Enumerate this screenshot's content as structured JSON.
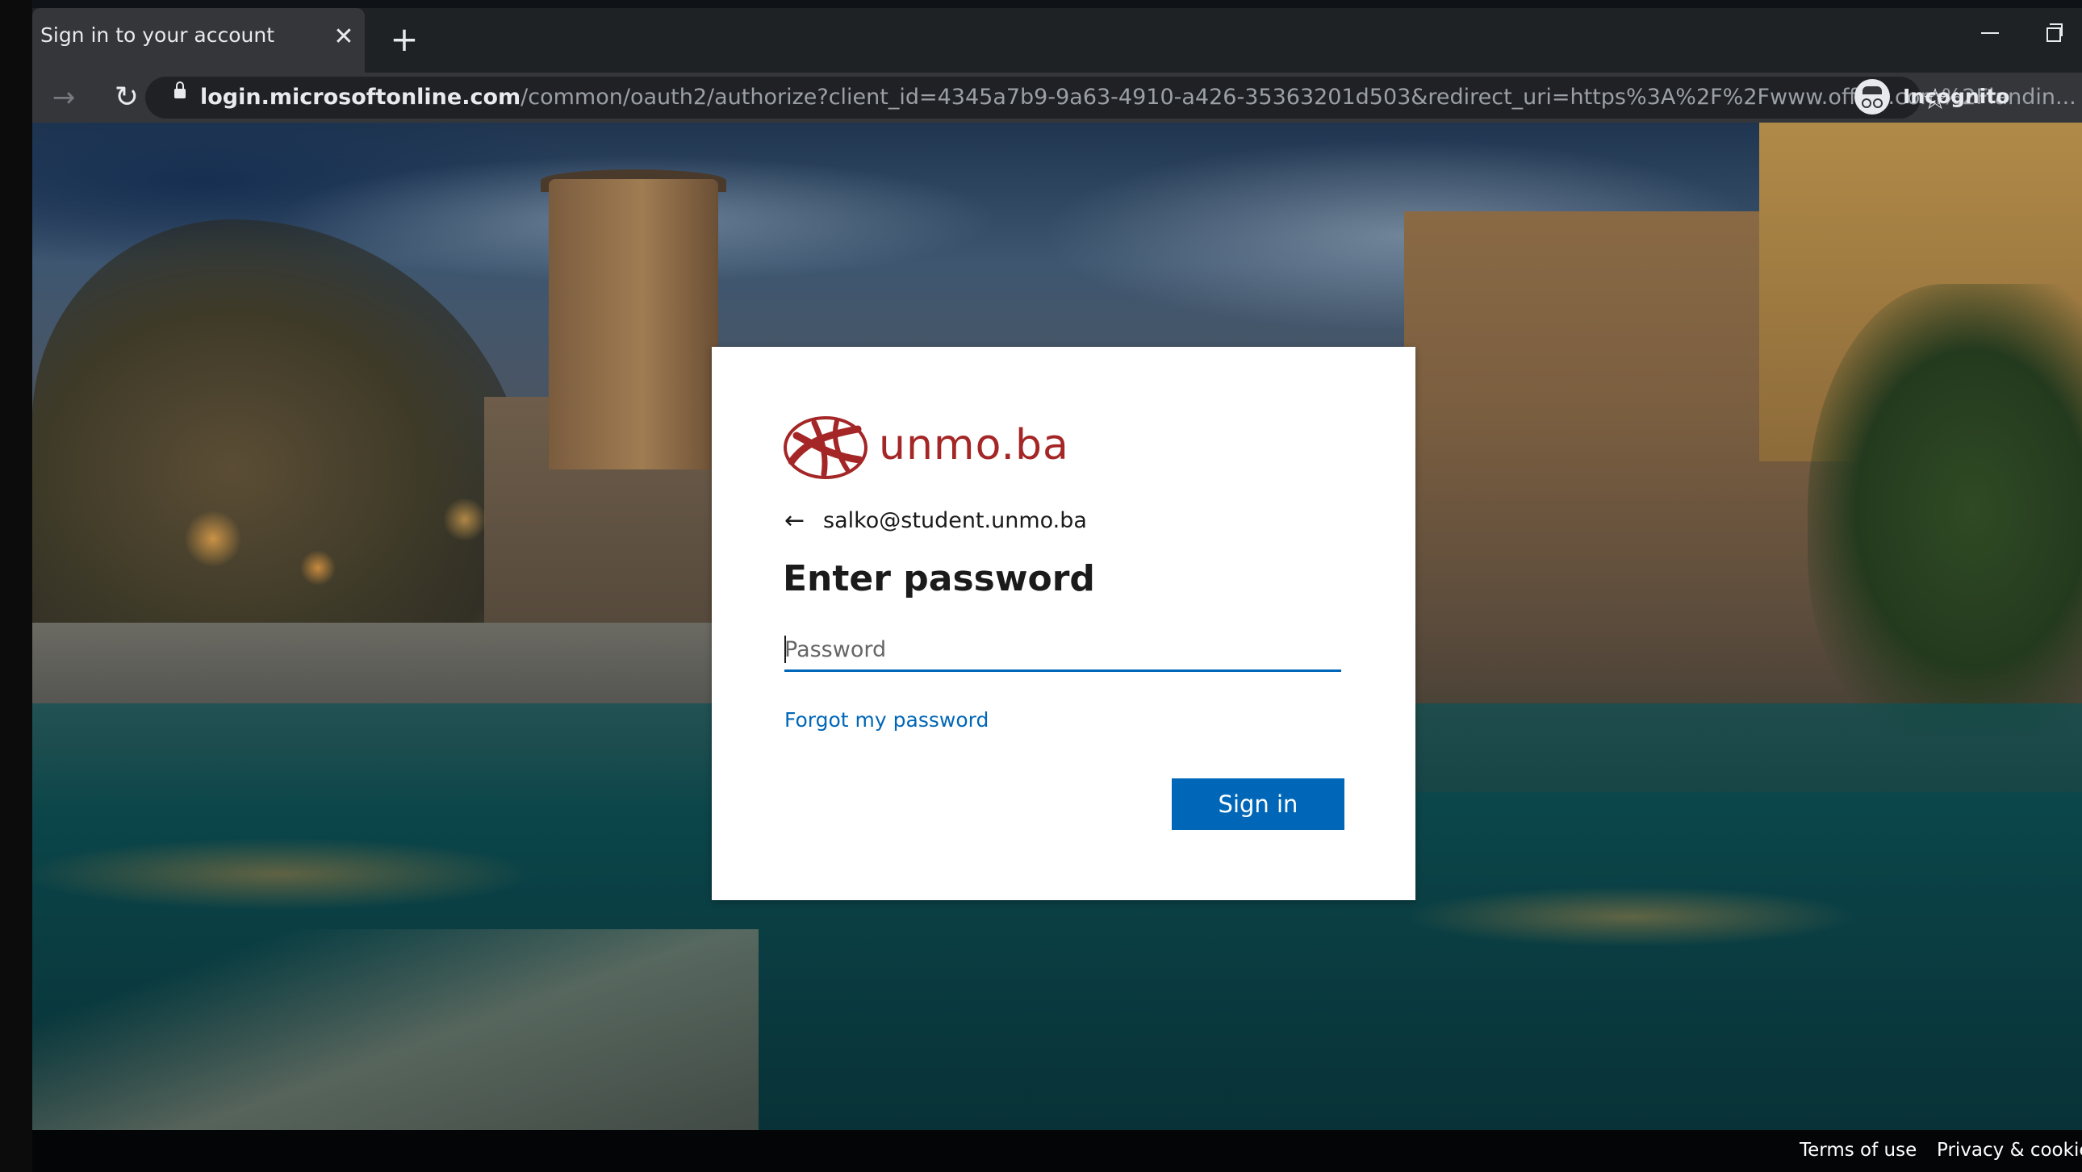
{
  "browser": {
    "tab_title": "Sign in to your account",
    "tab_close_icon": "close-icon",
    "new_tab_icon": "plus-icon",
    "url_host": "login.microsoftonline.com",
    "url_path": "/common/oauth2/authorize?client_id=4345a7b9-9a63-4910-a426-35363201d503&redirect_uri=https%3A%2F%2Fwww.office.com%2Flandin...",
    "incognito_label": "Incognito"
  },
  "card": {
    "logo_text": "unmo.ba",
    "identity": "salko@student.unmo.ba",
    "title": "Enter password",
    "password_placeholder": "Password",
    "password_value": "",
    "forgot_link": "Forgot my password",
    "signin_button": "Sign in",
    "accent_color": "#0067b8",
    "logo_color": "#a42626"
  },
  "footer": {
    "terms": "Terms of use",
    "privacy": "Privacy & cookies"
  }
}
